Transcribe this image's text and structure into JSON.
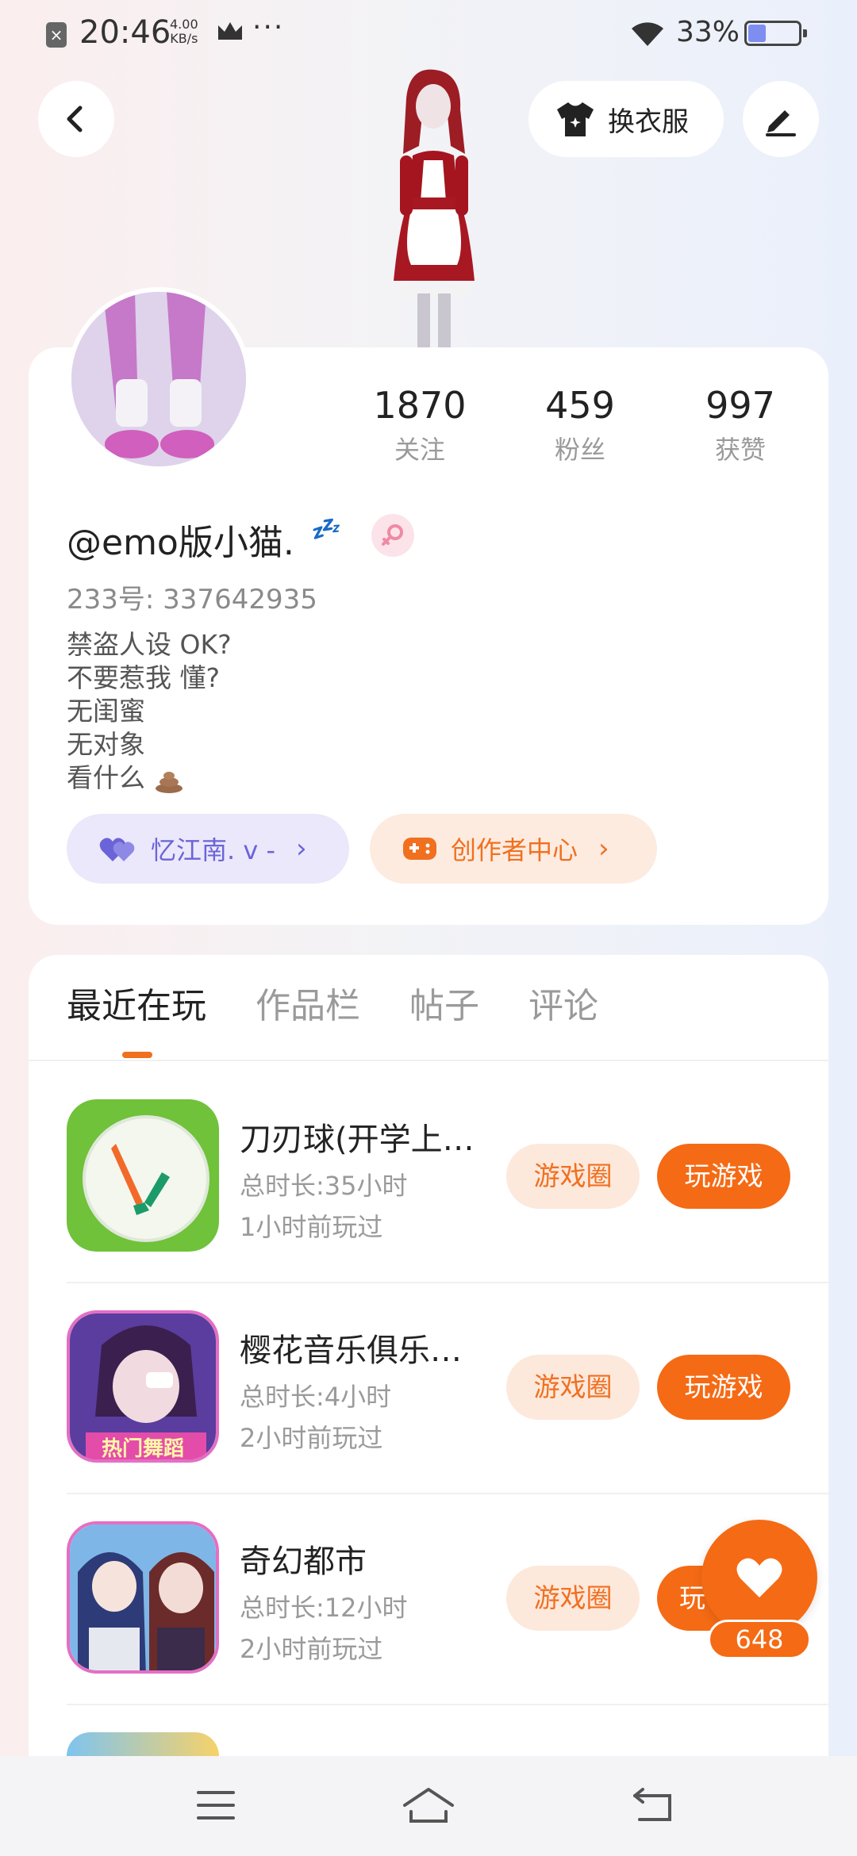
{
  "status_bar": {
    "time": "20:46",
    "net_speed_value": "4.00",
    "net_speed_unit": "KB/s",
    "battery": "33%",
    "notification_icon": "close-box-icon",
    "crown_icon": "crown-icon"
  },
  "header": {
    "back_icon": "chevron-left-icon",
    "dress_label": "换衣服",
    "edit_icon": "pen-icon"
  },
  "profile": {
    "stats": [
      {
        "value": "1870",
        "label": "关注"
      },
      {
        "value": "459",
        "label": "粉丝"
      },
      {
        "value": "997",
        "label": "获赞"
      }
    ],
    "nickname": "@emo版小猫.",
    "zzz": "💤",
    "gender_icon": "female-icon",
    "uid_label": "233号:",
    "uid_value": "337642935",
    "bio": [
      "禁盗人设 OK?",
      "不要惹我 懂?",
      "无闺蜜",
      "无对象",
      "看什么"
    ],
    "friend_pill": "忆江南. v -",
    "creator_pill": "创作者中心"
  },
  "tabs": [
    {
      "label": "最近在玩",
      "active": true
    },
    {
      "label": "作品栏",
      "active": false
    },
    {
      "label": "帖子",
      "active": false
    },
    {
      "label": "评论",
      "active": false
    }
  ],
  "games": [
    {
      "title": "刀刃球(开学上…",
      "duration": "总时长:35小时",
      "last_played": "1小时前玩过",
      "circle_label": "游戏圈",
      "play_label": "玩游戏"
    },
    {
      "title": "樱花音乐俱乐…",
      "duration": "总时长:4小时",
      "last_played": "2小时前玩过",
      "circle_label": "游戏圈",
      "play_label": "玩游戏",
      "icon_caption": "热门舞蹈"
    },
    {
      "title": "奇幻都市",
      "duration": "总时长:12小时",
      "last_played": "2小时前玩过",
      "circle_label": "游戏圈",
      "play_label": "玩"
    }
  ],
  "fab": {
    "like_count": "648"
  },
  "colors": {
    "accent": "#f56a14",
    "accent_light": "#fde8dc",
    "friend_purple": "#6b64d8"
  }
}
